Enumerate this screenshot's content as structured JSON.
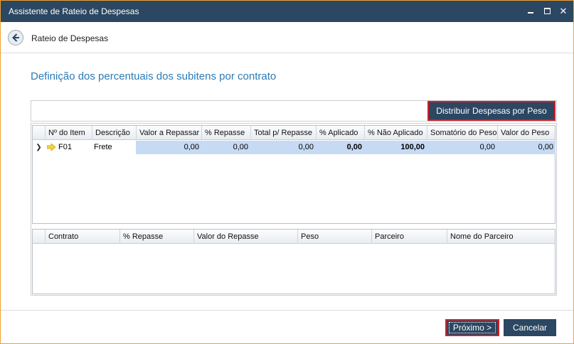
{
  "window": {
    "title": "Assistente de Rateio de Despesas"
  },
  "nav": {
    "label": "Rateio de Despesas"
  },
  "heading": "Definição dos percentuais dos subitens por contrato",
  "toolbar": {
    "distribute_label": "Distribuir Despesas por Peso"
  },
  "grid_items": {
    "columns": [
      "Nº do Item",
      "Descrição",
      "Valor a Repassar",
      "% Repasse",
      "Total p/ Repasse",
      "% Aplicado",
      "% Não Aplicado",
      "Somatório do Peso",
      "Valor do Peso"
    ],
    "rows": [
      {
        "item": "F01",
        "descricao": "Frete",
        "valor_repassar": "0,00",
        "repasse": "0,00",
        "total_repasse": "0,00",
        "aplicado": "0,00",
        "nao_aplicado": "100,00",
        "somatorio_peso": "0,00",
        "valor_peso": "0,00"
      }
    ]
  },
  "grid_contracts": {
    "columns": [
      "Contrato",
      "% Repasse",
      "Valor do Repasse",
      "Peso",
      "Parceiro",
      "Nome do Parceiro"
    ]
  },
  "footer": {
    "next_label": "Próximo >",
    "cancel_label": "Cancelar"
  },
  "colors": {
    "titlebar": "#2b4761",
    "accent": "#2b7bb6",
    "selection": "#c6daf4",
    "highlight_border": "#d0202a"
  }
}
